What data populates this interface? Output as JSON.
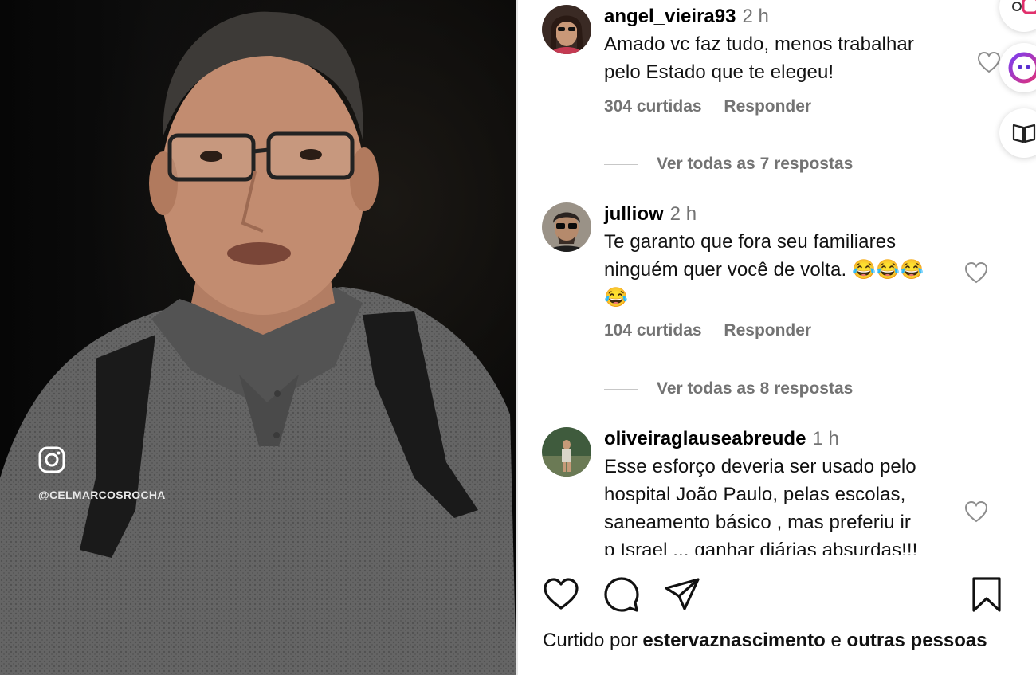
{
  "video": {
    "handle": "@CELMARCOSROCHA",
    "watermark_icon": "instagram-icon"
  },
  "comments": [
    {
      "username": "angel_vieira93",
      "time": "2 h",
      "lines": [
        "Amado vc faz tudo, menos trabalhar",
        "pelo Estado que te elegeu!"
      ],
      "likes": "304 curtidas",
      "reply": "Responder",
      "view_replies": "Ver todas as 7 respostas"
    },
    {
      "username": "julliow",
      "time": "2 h",
      "lines": [
        "Te garanto que fora seu familiares",
        "ninguém quer você de volta. 😂😂😂",
        "😂"
      ],
      "likes": "104 curtidas",
      "reply": "Responder",
      "view_replies": "Ver todas as 8 respostas"
    },
    {
      "username": "oliveiraglauseabreude",
      "time": "1 h",
      "lines": [
        "Esse esforço deveria ser usado pelo",
        "hospital João Paulo, pelas escolas,",
        "saneamento básico , mas preferiu ir",
        "p Israel ... ganhar diárias absurdas!!!"
      ]
    }
  ],
  "actions": {
    "like_icon": "heart-icon",
    "comment_icon": "comment-icon",
    "share_icon": "send-icon",
    "save_icon": "bookmark-icon"
  },
  "liked_by": {
    "prefix": "Curtido por ",
    "user": "estervaznascimento",
    "connector": " e ",
    "others": "outras pessoas"
  },
  "colors": {
    "text": "#111111",
    "muted": "#737373",
    "divider": "#e6e6e6"
  }
}
